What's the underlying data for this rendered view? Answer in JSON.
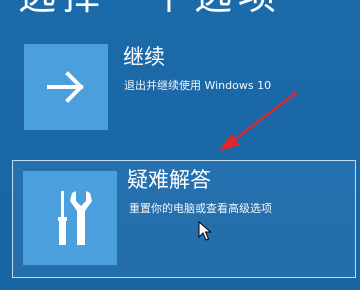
{
  "heading": "选择一个选项",
  "options": [
    {
      "title": "继续",
      "description": "退出并继续使用 Windows 10",
      "icon": "arrow-right-icon"
    },
    {
      "title": "疑难解答",
      "description": "重置你的电脑或查看高级选项",
      "icon": "tools-icon"
    }
  ],
  "annotation": {
    "color": "#e0262b",
    "icon": "red-pointer-arrow"
  },
  "colors": {
    "background": "#1a69a8",
    "tile": "#4b9fdd",
    "text": "#ffffff"
  }
}
